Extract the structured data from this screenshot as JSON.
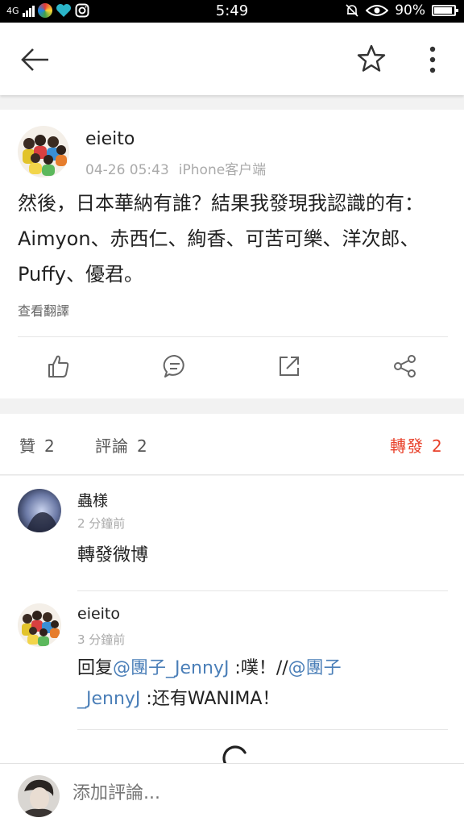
{
  "status_bar": {
    "network": "4G",
    "time": "5:49",
    "battery": "90%"
  },
  "post": {
    "author": "eieito",
    "date": "04-26 05:43",
    "client": "iPhone客户端",
    "text": "然後，日本華納有誰？結果我發現我認識的有：Aimyon、赤西仁、絢香、可苦可樂、洋次郎、Puffy、優君。",
    "translate_label": "查看翻譯"
  },
  "actions": {
    "like": "thumbs-up-icon",
    "comment": "comment-icon",
    "repost": "share-out-icon",
    "share": "share-icon"
  },
  "tabs": [
    {
      "label": "贊",
      "count": "2"
    },
    {
      "label": "評論",
      "count": "2"
    },
    {
      "label": "轉發",
      "count": "2"
    }
  ],
  "colors": {
    "accent": "#e8402a",
    "mention": "#4b7fb8"
  },
  "comments": [
    {
      "author": "蟲様",
      "time": "2 分鐘前",
      "text": "轉發微博"
    },
    {
      "author": "eieito",
      "time": "3 分鐘前",
      "line1_a": "回复",
      "mention1": "@團子_JennyJ",
      "line1_b": " :噗！//",
      "mention2_part1": "@團子",
      "mention2_part2": "_JennyJ",
      "line2_b": " :还有WANIMA！"
    }
  ],
  "input": {
    "placeholder": "添加評論..."
  }
}
